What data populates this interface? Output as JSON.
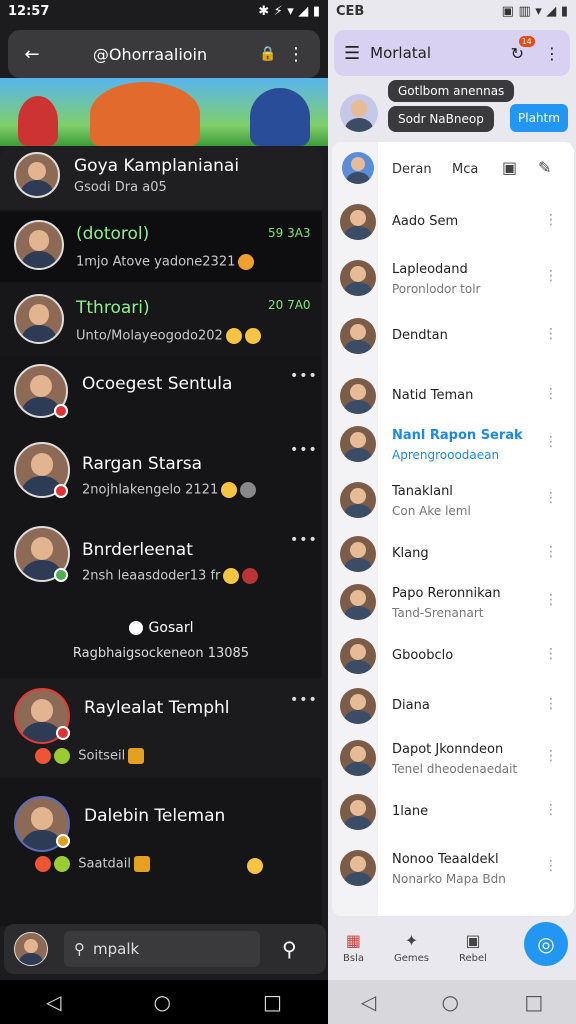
{
  "left": {
    "status": {
      "time": "12:57",
      "icons": "⊖ ⊙",
      "right_icons": "✱ ⚡ ▾ ◢ ▮"
    },
    "topbar": {
      "title": "@Ohorraalioin",
      "back": "←",
      "lock": "🔒",
      "more": "⋮"
    },
    "header_item": {
      "name": "Goya Kamplanianai",
      "sub": "Gsodi Dra a05"
    },
    "chats": [
      {
        "name": "(dotorol)",
        "sub": "1mjo Atove yadone2321",
        "time": "59 3A3",
        "highlight": true
      },
      {
        "name": "Tthroari)",
        "sub": "Unto/Molayeogodo202",
        "time": "20 7A0",
        "highlight": true
      },
      {
        "name": "Ocoegest Sentula",
        "sub": ""
      },
      {
        "name": "Rargan Starsa",
        "sub": "2nojhlakengelo 2121"
      },
      {
        "name": "Bnrderleenat",
        "sub": "2nsh leaasdoder13 fr"
      }
    ],
    "section": {
      "label": "Gosarl",
      "sub": "Ragbhaigsockeneon 13085"
    },
    "chats2": [
      {
        "name": "Raylealat Temphl",
        "sub": "Soitseil"
      },
      {
        "name": "Dalebin Teleman",
        "sub": "Saatdail"
      }
    ],
    "search": {
      "placeholder": "mpalk",
      "icon": "🔍"
    },
    "nav": {
      "back": "◁",
      "home": "○",
      "recent": "□"
    }
  },
  "right": {
    "status": {
      "time": "CEB",
      "icons": "▣ ⊖ ⊙",
      "right_icons": "▣ ▥ ▾ ◢ ▮"
    },
    "topbar": {
      "title": "Morlatal",
      "badge": "14"
    },
    "tips": {
      "t1": "Gotlbom anennas",
      "t2": "Sodr NaBneop",
      "btn": "Plahtm"
    },
    "tabs": {
      "t1": "Deran",
      "t2": "Mca"
    },
    "contacts": [
      {
        "name": "Aado Sem",
        "sub": ""
      },
      {
        "name": "Lapleodand",
        "sub": "Poronlodor tolr"
      },
      {
        "name": "Dendtan",
        "sub": ""
      },
      {
        "name": "Natid Teman",
        "sub": ""
      },
      {
        "name": "Nanl Rapon Serak",
        "sub": "Aprengrooodaean",
        "accent": true
      },
      {
        "name": "Tanaklanl",
        "sub": "Con Ake leml"
      },
      {
        "name": "Klang",
        "sub": ""
      },
      {
        "name": "Papo Reronnikan",
        "sub": "Tand-Srenanart"
      },
      {
        "name": "Gboobclo",
        "sub": ""
      },
      {
        "name": "Diana",
        "sub": ""
      },
      {
        "name": "Dapot Jkonndeon",
        "sub": "Tenel dheodenaedait"
      },
      {
        "name": "1lane",
        "sub": ""
      },
      {
        "name": "Nonoo Teaaldekl",
        "sub": "Nonarko Mapa Bdn"
      }
    ],
    "nav": {
      "b1": "Bsla",
      "b2": "Gemes",
      "b3": "Rebel",
      "back": "◁",
      "home": "○",
      "recent": "□"
    }
  },
  "colors": {
    "accent_blue": "#2196f3",
    "chat_time": "#7be37b",
    "purple_bar": "#d9d1f1"
  }
}
